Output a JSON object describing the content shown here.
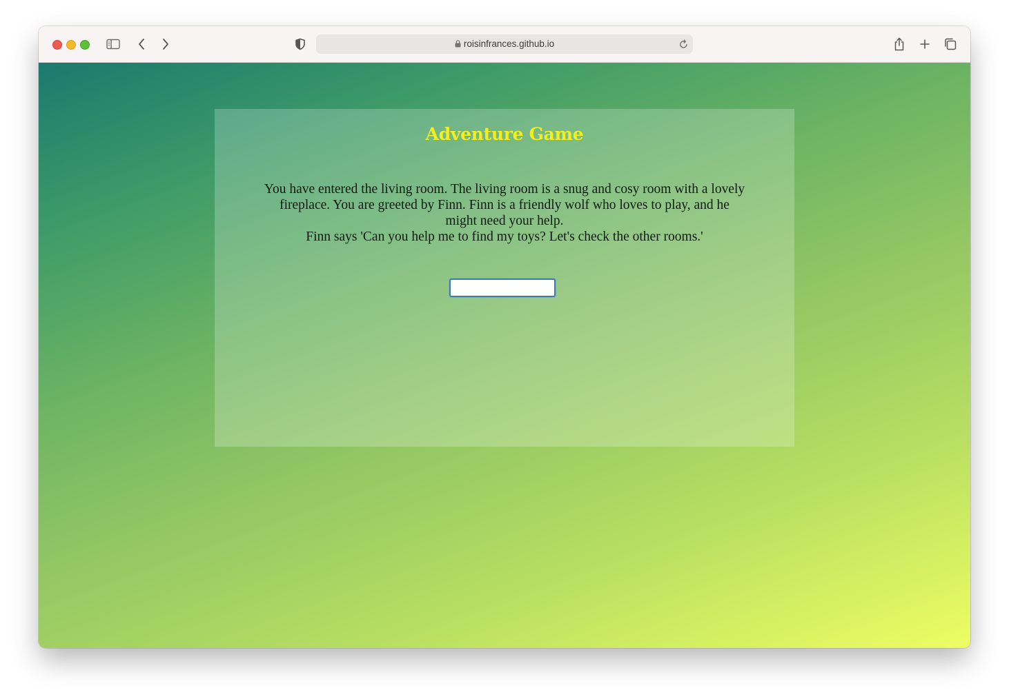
{
  "browser": {
    "url": "roisinfrances.github.io",
    "icons": {
      "close": "close-window",
      "minimize": "minimize-window",
      "maximize": "maximize-window",
      "sidebar": "sidebar-icon",
      "back": "chevron-left-icon",
      "forward": "chevron-right-icon",
      "privacy": "shield-icon",
      "lock": "lock-icon",
      "reload": "reload-icon",
      "share": "share-icon",
      "new_tab": "plus-icon",
      "tabs": "tab-overview-icon"
    }
  },
  "game": {
    "title": "Adventure Game",
    "story_lines": [
      "You have entered the living room. The living room is a snug and cosy room with a lovely fireplace. You are greeted by Finn. Finn is a friendly wolf who loves to play, and he might need your help.",
      "Finn says 'Can you help me to find my toys? Let's check the other rooms.'"
    ],
    "input_value": ""
  },
  "colors": {
    "title": "#f3ef1c",
    "gradient_start": "#1a7a6e",
    "gradient_end": "#eefd62",
    "input_border": "#3f7bb3"
  }
}
